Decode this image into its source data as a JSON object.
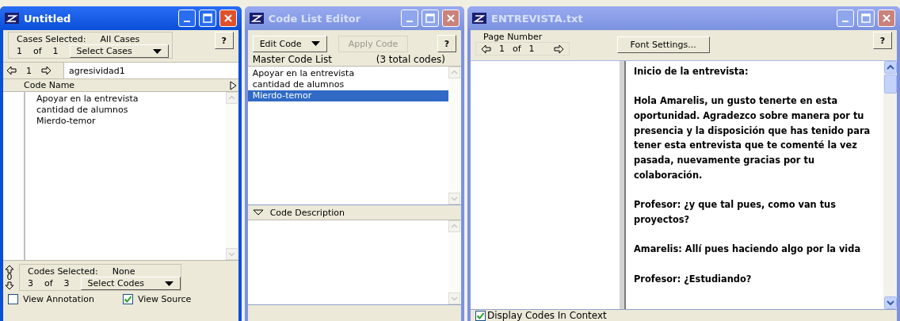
{
  "case_window": {
    "title": "Untitled",
    "active": true,
    "cases_selected_label": "Cases Selected:",
    "cases_selected_value": "All Cases",
    "case_index": "1",
    "of_label": "of",
    "case_total": "1",
    "select_cases_button": "Select Cases",
    "help_button": "?",
    "record_number": "1",
    "record_name": "agresividad1",
    "column_header": "Code Name",
    "codes": [
      "Apoyar en la entrevista",
      "cantidad de alumnos",
      "Mierdo-temor"
    ],
    "scroll_count": "0",
    "codes_selected_label": "Codes Selected:",
    "codes_selected_value": "None",
    "code_index": "3",
    "code_of_label": "of",
    "code_total": "3",
    "select_codes_button": "Select Codes",
    "options": [
      {
        "label": "View Annotation",
        "checked": false
      },
      {
        "label": "View Source",
        "checked": true
      }
    ]
  },
  "code_list_editor": {
    "title": "Code List Editor",
    "active": false,
    "edit_code_button": "Edit Code",
    "apply_code_button": {
      "label": "Apply Code",
      "disabled": true
    },
    "help_button": "?",
    "list_label": "Master Code List",
    "list_count": "(3 total codes)",
    "codes": [
      {
        "label": "Apoyar en la entrevista",
        "selected": false
      },
      {
        "label": "cantidad de alumnos",
        "selected": false
      },
      {
        "label": "Mierdo-temor",
        "selected": true
      }
    ],
    "description_header": {
      "label": "Code Description",
      "expanded": true
    }
  },
  "document_window": {
    "title": "ENTREVISTA.txt",
    "active": false,
    "page_number_label": "Page Number",
    "page_index": "1",
    "of_label": "of",
    "page_total": "1",
    "font_settings_button": "Font Settings...",
    "help_button": "?",
    "paragraphs": [
      "Inicio de la entrevista:",
      "Hola Amarelis, un gusto tenerte en esta oportunidad. Agradezco sobre manera por tu presencia y la disposición que has tenido para tener esta entrevista que te comenté la vez pasada, nuevamente gracias por tu colaboración.",
      "Profesor: ¿y que tal pues, como van tus proyectos?",
      "Amarelis: Allí pues haciendo algo por la vida",
      "Profesor: ¿Estudiando?"
    ],
    "display_codes": {
      "label": "Display Codes In Context",
      "checked": true
    }
  }
}
